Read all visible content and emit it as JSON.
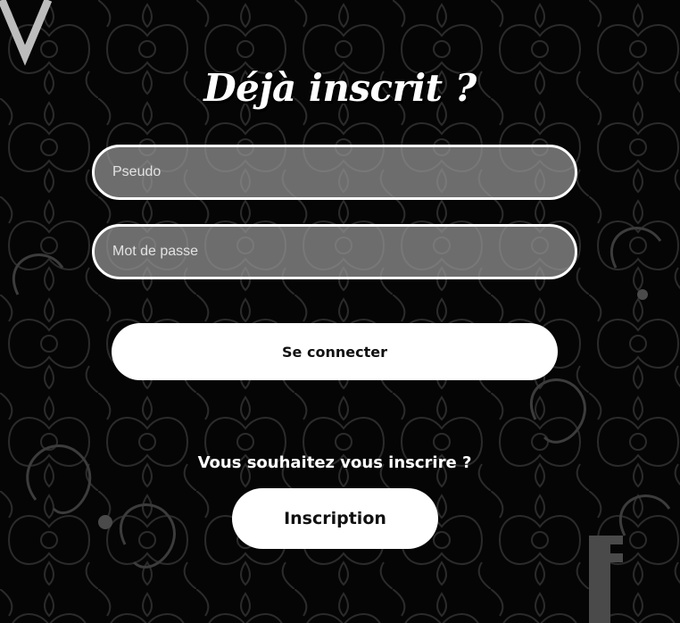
{
  "login": {
    "title": "Déjà inscrit ?",
    "pseudo_placeholder": "Pseudo",
    "password_placeholder": "Mot de passe",
    "connect_label": "Se connecter"
  },
  "signup": {
    "prompt": "Vous souhaitez vous inscrire ?",
    "button_label": "Inscription"
  },
  "colors": {
    "background": "#050505",
    "ornament": "#3a3a3a",
    "field_fill": "#969696",
    "button": "#ffffff"
  }
}
